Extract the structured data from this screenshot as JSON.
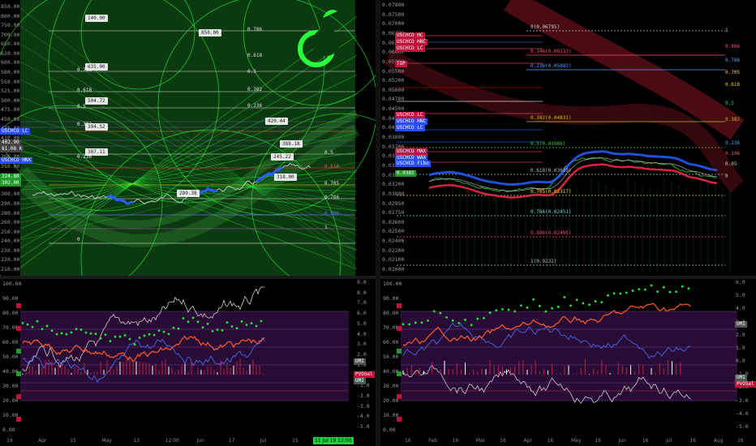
{
  "colors": {
    "bg": "#000000",
    "green_field": "#0c3a10",
    "neon_green": "#27ff3a",
    "purple_band": "#2c0d3c",
    "red_line": "#e03030",
    "blue": "#2a5cff",
    "white_price": "#dddddd"
  },
  "top_left": {
    "y_ticks": [
      "850.00",
      "800.00",
      "750.00",
      "700.00",
      "650.00",
      "620.00",
      "600.00",
      "580.00",
      "550.00",
      "525.00",
      "500.00",
      "475.00",
      "450.00",
      "430.00",
      "410.00",
      "390.00",
      "360.00",
      "350.00",
      "330.00",
      "310.00",
      "300.00",
      "290.00",
      "280.00",
      "260.00",
      "250.00",
      "240.00",
      "230.00",
      "220.00",
      "210.00"
    ],
    "fib_levels": [
      "0.786",
      "0.618",
      "0.5",
      "0.382",
      "0.236",
      "0",
      "0.618",
      "0.786",
      "0.5"
    ],
    "left_fib_labels": [
      "0.786",
      "0.618",
      "0.5",
      "0.382",
      "0.236",
      "0"
    ],
    "right_fib_labels": [
      "0.786",
      "0.618",
      "0.5",
      "0.382",
      "0.236",
      "0.5",
      "0.618",
      "0.705",
      "0.786",
      "0.886",
      "1"
    ],
    "price_boxes": [
      "140.00",
      "850.00",
      "635.00",
      "504.72",
      "394.52",
      "387.11",
      "289.38",
      "420.44",
      "388.18",
      "318.00",
      "245.22"
    ],
    "left_tags": [
      "USCHCO LC",
      "402.90",
      "81.08 K",
      "USCHCO HNX",
      "324.80",
      "302.00"
    ],
    "date_labels": [
      "Apr",
      "15",
      "May",
      "13",
      "12:00",
      "Jun",
      "17",
      "Jul",
      "15"
    ],
    "crosshair_date": "11 Jul 19",
    "crosshair_time": "12:00"
  },
  "top_right": {
    "y_ticks": [
      "0.07800",
      "0.07500",
      "0.07000",
      "0.06700",
      "0.06500",
      "0.06000",
      "0.05900",
      "0.05500",
      "0.05200",
      "0.05000",
      "0.04700",
      "0.04500",
      "0.04300",
      "0.04000",
      "0.03800",
      "0.03700",
      "0.03500",
      "0.03400",
      "0.03300",
      "0.03200",
      "0.03000",
      "0.02950",
      "0.02750",
      "0.02600",
      "0.02500",
      "0.02400",
      "0.02200",
      "0.02100",
      "0.02000"
    ],
    "fib_lines": [
      {
        "label": "0(0.06795)",
        "color": "#cccccc"
      },
      {
        "label": "0.146(0.06133)",
        "color": "#ff4d6d"
      },
      {
        "label": "0.236(0.05882)",
        "color": "#4da3ff"
      },
      {
        "label": "0.382(0.04831)",
        "color": "#c3c300"
      },
      {
        "label": "0.5(0.03986)",
        "color": "#3ad13a"
      },
      {
        "label": "0.618(0.03039)",
        "color": "#c0c0c0"
      },
      {
        "label": "0.705(0.02317)",
        "color": "#ffd400"
      },
      {
        "label": "0.786(0.02451)",
        "color": "#6fd3d3"
      },
      {
        "label": "0.886(0.02495)",
        "color": "#ff3d8a"
      },
      {
        "label": "1(0.0232)",
        "color": "#c0c0c0"
      }
    ],
    "right_fib_labels": [
      "1",
      "0.886",
      "0.786",
      "0.705",
      "0.618",
      "0.5",
      "0.382",
      "0.236",
      "0.146",
      "0.05",
      "0"
    ],
    "left_tags": [
      "USCHCO HC",
      "USCHCO HNC",
      "USCHCO LC",
      "TOP",
      "USCHCO LC",
      "USCHCO HNC",
      "USCHCO LC",
      "USCHCO MAX",
      "USCHCO WAX",
      "USCHCO Fibo",
      "0.0381"
    ],
    "date_labels": [
      "16",
      "Feb",
      "16",
      "Mar",
      "16",
      "Apr",
      "16",
      "May",
      "16",
      "Jun",
      "16",
      "Jul",
      "16",
      "Aug",
      "16"
    ]
  },
  "bottom_left": {
    "y_ticks_left": [
      "100.00",
      "90.00",
      "80.00",
      "70.00",
      "60.00",
      "50.00",
      "40.00",
      "30.00",
      "20.00",
      "10.00",
      "0.00"
    ],
    "y_ticks_right": [
      "9.0",
      "8.0",
      "7.0",
      "6.0",
      "5.0",
      "4.0",
      "3.0",
      "2.0",
      "1.0",
      "0.0",
      "-1.0",
      "-2.0",
      "-3.0",
      "-4.0",
      "-5.0"
    ],
    "right_tags": [
      "UMI",
      "PVOSel",
      "UMI"
    ],
    "date_labels": [
      "19",
      "Apr",
      "15",
      "May",
      "13",
      "12:00",
      "Jun",
      "17",
      "Jul",
      "15"
    ]
  },
  "bottom_right": {
    "y_ticks_left": [
      "100.00",
      "90.00",
      "80.00",
      "70.00",
      "60.00",
      "50.00",
      "40.00",
      "30.00",
      "20.00",
      "10.00",
      "0.00"
    ],
    "y_ticks_right": [
      "6.0",
      "5.0",
      "4.0",
      "3.0",
      "2.0",
      "1.0",
      "0.0",
      "-1.0",
      "-2.0",
      "-3.0",
      "-4.0",
      "-5.0"
    ],
    "right_tags": [
      "UMI",
      "UMI",
      "PVOSel"
    ],
    "date_labels": [
      "16",
      "Feb",
      "16",
      "Mar",
      "16",
      "Apr",
      "16",
      "May",
      "16",
      "Jun",
      "16",
      "Jul",
      "16",
      "Aug",
      "16"
    ]
  }
}
